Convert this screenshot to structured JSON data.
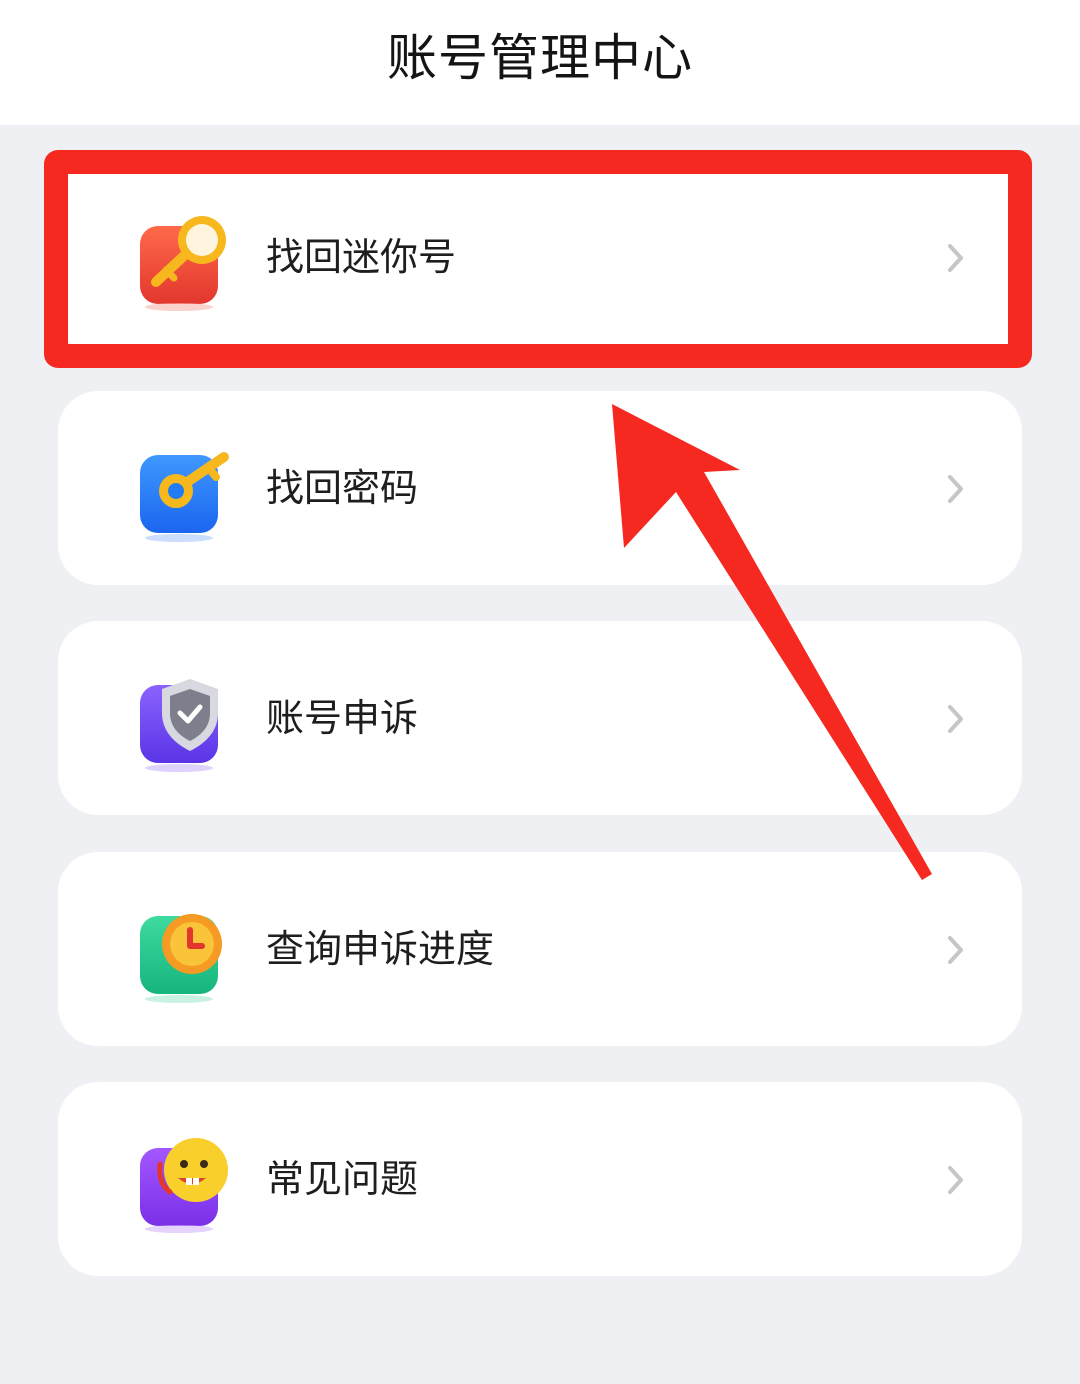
{
  "header": {
    "title": "账号管理中心"
  },
  "menu": {
    "items": [
      {
        "label": "找回迷你号",
        "icon": "key-search-icon",
        "icon_color": "#ee4b3c"
      },
      {
        "label": "找回密码",
        "icon": "key-icon",
        "icon_color": "#1f7cf5"
      },
      {
        "label": "账号申诉",
        "icon": "shield-check-icon",
        "icon_color": "#6f4cf0"
      },
      {
        "label": "查询申诉进度",
        "icon": "clock-icon",
        "icon_color": "#1fc58b"
      },
      {
        "label": "常见问题",
        "icon": "smiley-help-icon",
        "icon_color": "#8a3df0"
      }
    ]
  },
  "annotation": {
    "highlight_color": "#f52920"
  }
}
